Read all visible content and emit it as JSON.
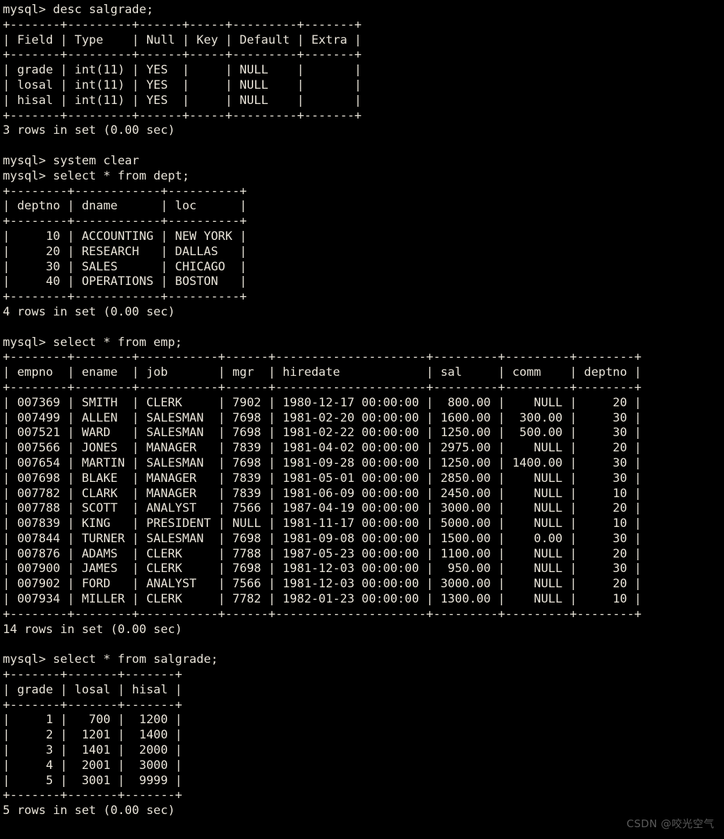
{
  "terminal": {
    "prompt": "mysql> ",
    "background_color": "#000000",
    "text_color": "#e8e3d8",
    "commands": [
      "desc salgrade;",
      "system clear",
      "select * from dept;",
      "select * from emp;",
      "select * from salgrade;"
    ],
    "lines": [
      "mysql> desc salgrade;",
      "+-------+---------+------+-----+---------+-------+",
      "| Field | Type    | Null | Key | Default | Extra |",
      "+-------+---------+------+-----+---------+-------+",
      "| grade | int(11) | YES  |     | NULL    |       |",
      "| losal | int(11) | YES  |     | NULL    |       |",
      "| hisal | int(11) | YES  |     | NULL    |       |",
      "+-------+---------+------+-----+---------+-------+",
      "3 rows in set (0.00 sec)",
      "",
      "mysql> system clear",
      "mysql> select * from dept;",
      "+--------+------------+----------+",
      "| deptno | dname      | loc      |",
      "+--------+------------+----------+",
      "|     10 | ACCOUNTING | NEW YORK |",
      "|     20 | RESEARCH   | DALLAS   |",
      "|     30 | SALES      | CHICAGO  |",
      "|     40 | OPERATIONS | BOSTON   |",
      "+--------+------------+----------+",
      "4 rows in set (0.00 sec)",
      "",
      "mysql> select * from emp;",
      "+--------+--------+-----------+------+---------------------+---------+---------+--------+",
      "| empno  | ename  | job       | mgr  | hiredate            | sal     | comm    | deptno |",
      "+--------+--------+-----------+------+---------------------+---------+---------+--------+",
      "| 007369 | SMITH  | CLERK     | 7902 | 1980-12-17 00:00:00 |  800.00 |    NULL |     20 |",
      "| 007499 | ALLEN  | SALESMAN  | 7698 | 1981-02-20 00:00:00 | 1600.00 |  300.00 |     30 |",
      "| 007521 | WARD   | SALESMAN  | 7698 | 1981-02-22 00:00:00 | 1250.00 |  500.00 |     30 |",
      "| 007566 | JONES  | MANAGER   | 7839 | 1981-04-02 00:00:00 | 2975.00 |    NULL |     20 |",
      "| 007654 | MARTIN | SALESMAN  | 7698 | 1981-09-28 00:00:00 | 1250.00 | 1400.00 |     30 |",
      "| 007698 | BLAKE  | MANAGER   | 7839 | 1981-05-01 00:00:00 | 2850.00 |    NULL |     30 |",
      "| 007782 | CLARK  | MANAGER   | 7839 | 1981-06-09 00:00:00 | 2450.00 |    NULL |     10 |",
      "| 007788 | SCOTT  | ANALYST   | 7566 | 1987-04-19 00:00:00 | 3000.00 |    NULL |     20 |",
      "| 007839 | KING   | PRESIDENT | NULL | 1981-11-17 00:00:00 | 5000.00 |    NULL |     10 |",
      "| 007844 | TURNER | SALESMAN  | 7698 | 1981-09-08 00:00:00 | 1500.00 |    0.00 |     30 |",
      "| 007876 | ADAMS  | CLERK     | 7788 | 1987-05-23 00:00:00 | 1100.00 |    NULL |     20 |",
      "| 007900 | JAMES  | CLERK     | 7698 | 1981-12-03 00:00:00 |  950.00 |    NULL |     30 |",
      "| 007902 | FORD   | ANALYST   | 7566 | 1981-12-03 00:00:00 | 3000.00 |    NULL |     20 |",
      "| 007934 | MILLER | CLERK     | 7782 | 1982-01-23 00:00:00 | 1300.00 |    NULL |     10 |",
      "+--------+--------+-----------+------+---------------------+---------+---------+--------+",
      "14 rows in set (0.00 sec)",
      "",
      "mysql> select * from salgrade;",
      "+-------+-------+-------+",
      "| grade | losal | hisal |",
      "+-------+-------+-------+",
      "|     1 |   700 |  1200 |",
      "|     2 |  1201 |  1400 |",
      "|     3 |  1401 |  2000 |",
      "|     4 |  2001 |  3000 |",
      "|     5 |  3001 |  9999 |",
      "+-------+-------+-------+",
      "5 rows in set (0.00 sec)"
    ],
    "results": {
      "desc_salgrade": {
        "columns": [
          "Field",
          "Type",
          "Null",
          "Key",
          "Default",
          "Extra"
        ],
        "rows": [
          [
            "grade",
            "int(11)",
            "YES",
            "",
            "NULL",
            ""
          ],
          [
            "losal",
            "int(11)",
            "YES",
            "",
            "NULL",
            ""
          ],
          [
            "hisal",
            "int(11)",
            "YES",
            "",
            "NULL",
            ""
          ]
        ],
        "status": "3 rows in set (0.00 sec)"
      },
      "dept": {
        "columns": [
          "deptno",
          "dname",
          "loc"
        ],
        "rows": [
          [
            "10",
            "ACCOUNTING",
            "NEW YORK"
          ],
          [
            "20",
            "RESEARCH",
            "DALLAS"
          ],
          [
            "30",
            "SALES",
            "CHICAGO"
          ],
          [
            "40",
            "OPERATIONS",
            "BOSTON"
          ]
        ],
        "status": "4 rows in set (0.00 sec)"
      },
      "emp": {
        "columns": [
          "empno",
          "ename",
          "job",
          "mgr",
          "hiredate",
          "sal",
          "comm",
          "deptno"
        ],
        "rows": [
          [
            "007369",
            "SMITH",
            "CLERK",
            "7902",
            "1980-12-17 00:00:00",
            "800.00",
            "NULL",
            "20"
          ],
          [
            "007499",
            "ALLEN",
            "SALESMAN",
            "7698",
            "1981-02-20 00:00:00",
            "1600.00",
            "300.00",
            "30"
          ],
          [
            "007521",
            "WARD",
            "SALESMAN",
            "7698",
            "1981-02-22 00:00:00",
            "1250.00",
            "500.00",
            "30"
          ],
          [
            "007566",
            "JONES",
            "MANAGER",
            "7839",
            "1981-04-02 00:00:00",
            "2975.00",
            "NULL",
            "20"
          ],
          [
            "007654",
            "MARTIN",
            "SALESMAN",
            "7698",
            "1981-09-28 00:00:00",
            "1250.00",
            "1400.00",
            "30"
          ],
          [
            "007698",
            "BLAKE",
            "MANAGER",
            "7839",
            "1981-05-01 00:00:00",
            "2850.00",
            "NULL",
            "30"
          ],
          [
            "007782",
            "CLARK",
            "MANAGER",
            "7839",
            "1981-06-09 00:00:00",
            "2450.00",
            "NULL",
            "10"
          ],
          [
            "007788",
            "SCOTT",
            "ANALYST",
            "7566",
            "1987-04-19 00:00:00",
            "3000.00",
            "NULL",
            "20"
          ],
          [
            "007839",
            "KING",
            "PRESIDENT",
            "NULL",
            "1981-11-17 00:00:00",
            "5000.00",
            "NULL",
            "10"
          ],
          [
            "007844",
            "TURNER",
            "SALESMAN",
            "7698",
            "1981-09-08 00:00:00",
            "1500.00",
            "0.00",
            "30"
          ],
          [
            "007876",
            "ADAMS",
            "CLERK",
            "7788",
            "1987-05-23 00:00:00",
            "1100.00",
            "NULL",
            "20"
          ],
          [
            "007900",
            "JAMES",
            "CLERK",
            "7698",
            "1981-12-03 00:00:00",
            "950.00",
            "NULL",
            "30"
          ],
          [
            "007902",
            "FORD",
            "ANALYST",
            "7566",
            "1981-12-03 00:00:00",
            "3000.00",
            "NULL",
            "20"
          ],
          [
            "007934",
            "MILLER",
            "CLERK",
            "7782",
            "1982-01-23 00:00:00",
            "1300.00",
            "NULL",
            "10"
          ]
        ],
        "status": "14 rows in set (0.00 sec)"
      },
      "salgrade": {
        "columns": [
          "grade",
          "losal",
          "hisal"
        ],
        "rows": [
          [
            "1",
            "700",
            "1200"
          ],
          [
            "2",
            "1201",
            "1400"
          ],
          [
            "3",
            "1401",
            "2000"
          ],
          [
            "4",
            "2001",
            "3000"
          ],
          [
            "5",
            "3001",
            "9999"
          ]
        ],
        "status": "5 rows in set (0.00 sec)"
      }
    }
  },
  "watermark": {
    "text": "CSDN @咬光空气",
    "color": "#5a5a5a"
  }
}
